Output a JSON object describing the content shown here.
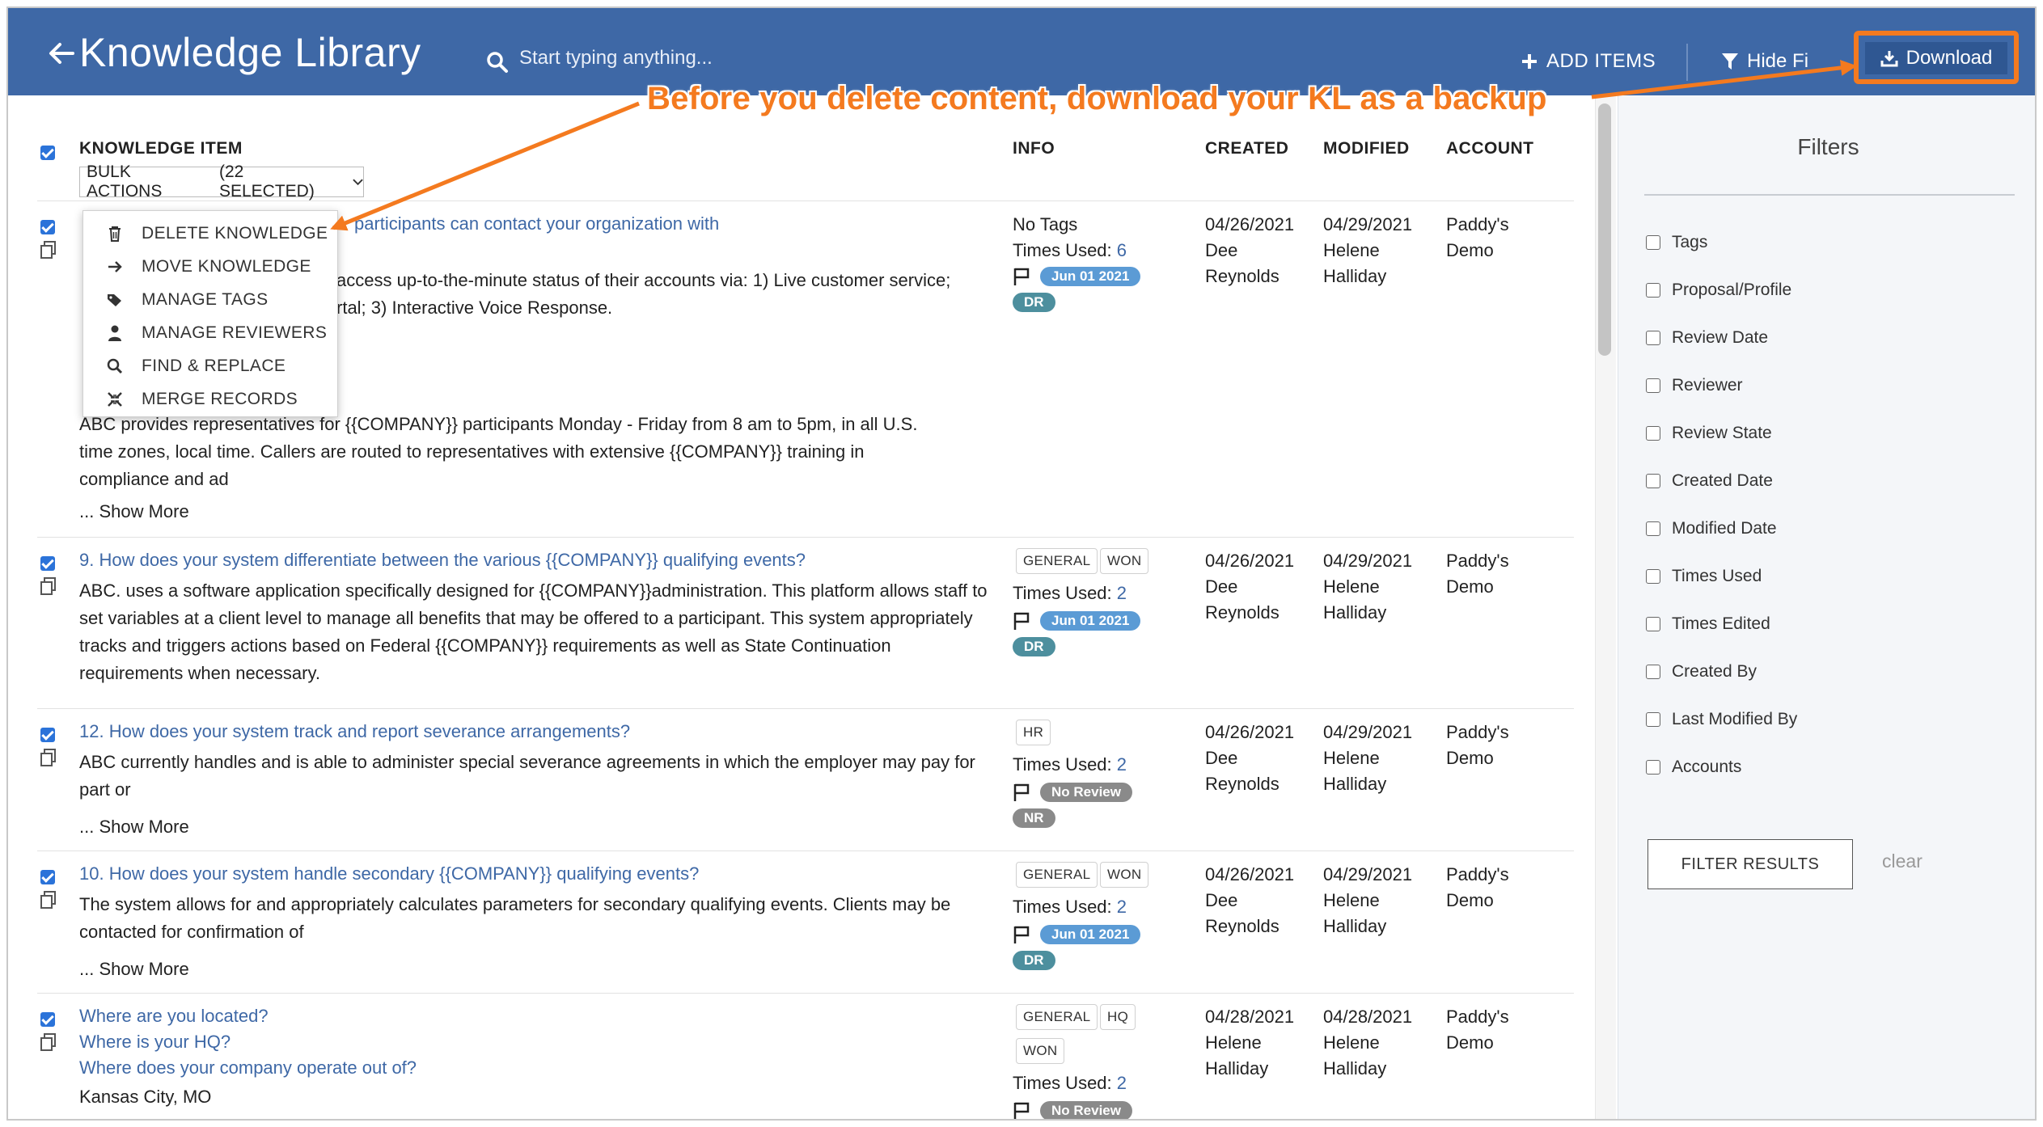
{
  "header": {
    "title": "Knowledge Library",
    "search_placeholder": "Start typing anything...",
    "add_items_label": "ADD ITEMS",
    "hide_filters_label": "Hide Fi",
    "download_label": "Download"
  },
  "annotation": {
    "text": "Before you delete content, download your KL as a backup",
    "color": "#f47a1f"
  },
  "columns": {
    "item": "KNOWLEDGE ITEM",
    "info": "INFO",
    "created": "CREATED",
    "modified": "MODIFIED",
    "account": "ACCOUNT"
  },
  "bulk": {
    "label": "BULK ACTIONS",
    "selected": "(22 SELECTED)"
  },
  "bulk_menu": [
    {
      "label": "DELETE KNOWLEDGE",
      "icon": "trash-icon"
    },
    {
      "label": "MOVE KNOWLEDGE",
      "icon": "arrow-right-icon"
    },
    {
      "label": "MANAGE TAGS",
      "icon": "tags-icon"
    },
    {
      "label": "MANAGE REVIEWERS",
      "icon": "user-icon"
    },
    {
      "label": "FIND & REPLACE",
      "icon": "search-icon"
    },
    {
      "label": "MERGE RECORDS",
      "icon": "merge-icon"
    }
  ],
  "rows": [
    {
      "question": "participants can contact your organization with",
      "answer_line1": "access up-to-the-minute status of their accounts via: 1) Live customer service;",
      "answer_line2": "rtal; 3) Interactive Voice Response.",
      "answer_line3": "ABC provides representatives for {{COMPANY}} participants Monday - Friday from 8 am to 5pm, in all U.S.",
      "answer_line4": "time zones, local time. Callers are routed to representatives with extensive {{COMPANY}} training in",
      "answer_line5": "compliance and ad",
      "show_more": "... Show More",
      "info_line": "No Tags",
      "times_used_label": "Times Used:",
      "times_used": "6",
      "review_pill": "Jun 01 2021",
      "reviewer_pill": "DR",
      "created_date": "04/26/2021",
      "created_by_1": "Dee",
      "created_by_2": "Reynolds",
      "modified_date": "04/29/2021",
      "modified_by_1": "Helene",
      "modified_by_2": "Halliday",
      "account_1": "Paddy's",
      "account_2": "Demo"
    },
    {
      "question": "9. How does your system differentiate between the various {{COMPANY}} qualifying events?",
      "answer": "ABC. uses a software application specifically designed for {{COMPANY}}administration. This platform allows staff to set variables at a client level to manage all benefits that may be offered to a participant. This system appropriately tracks and triggers actions based on Federal {{COMPANY}} requirements as well as State Continuation requirements when necessary.",
      "tags": [
        "GENERAL",
        "WON"
      ],
      "times_used_label": "Times Used:",
      "times_used": "2",
      "review_pill": "Jun 01 2021",
      "reviewer_pill": "DR",
      "created_date": "04/26/2021",
      "created_by_1": "Dee",
      "created_by_2": "Reynolds",
      "modified_date": "04/29/2021",
      "modified_by_1": "Helene",
      "modified_by_2": "Halliday",
      "account_1": "Paddy's",
      "account_2": "Demo"
    },
    {
      "question": "12. How does your system track and report severance arrangements?",
      "answer": "ABC currently handles and is able to administer special severance agreements in which the employer may pay for part or",
      "show_more": "... Show More",
      "tags": [
        "HR"
      ],
      "times_used_label": "Times Used:",
      "times_used": "2",
      "review_pill": "No Review",
      "reviewer_pill": "NR",
      "created_date": "04/26/2021",
      "created_by_1": "Dee",
      "created_by_2": "Reynolds",
      "modified_date": "04/29/2021",
      "modified_by_1": "Helene",
      "modified_by_2": "Halliday",
      "account_1": "Paddy's",
      "account_2": "Demo"
    },
    {
      "question": "10. How does your system handle secondary {{COMPANY}} qualifying events?",
      "answer": "The system allows for and appropriately calculates parameters for secondary qualifying events. Clients may be contacted for confirmation of",
      "show_more": "... Show More",
      "tags": [
        "GENERAL",
        "WON"
      ],
      "times_used_label": "Times Used:",
      "times_used": "2",
      "review_pill": "Jun 01 2021",
      "reviewer_pill": "DR",
      "created_date": "04/26/2021",
      "created_by_1": "Dee",
      "created_by_2": "Reynolds",
      "modified_date": "04/29/2021",
      "modified_by_1": "Helene",
      "modified_by_2": "Halliday",
      "account_1": "Paddy's",
      "account_2": "Demo"
    },
    {
      "question_1": "Where are you located?",
      "question_2": "Where is your HQ?",
      "question_3": "Where does your company operate out of?",
      "answer": "Kansas City, MO",
      "tags": [
        "GENERAL",
        "HQ",
        "WON"
      ],
      "times_used_label": "Times Used:",
      "times_used": "2",
      "review_pill": "No Review",
      "created_date": "04/28/2021",
      "created_by_1": "Helene",
      "created_by_2": "Halliday",
      "modified_date": "04/28/2021",
      "modified_by_1": "Helene",
      "modified_by_2": "Halliday",
      "account_1": "Paddy's",
      "account_2": "Demo"
    }
  ],
  "filters": {
    "title": "Filters",
    "items": [
      "Tags",
      "Proposal/Profile",
      "Review Date",
      "Reviewer",
      "Review State",
      "Created Date",
      "Modified Date",
      "Times Used",
      "Times Edited",
      "Created By",
      "Last Modified By",
      "Accounts"
    ],
    "filter_results_label": "FILTER RESULTS",
    "clear_label": "clear"
  }
}
